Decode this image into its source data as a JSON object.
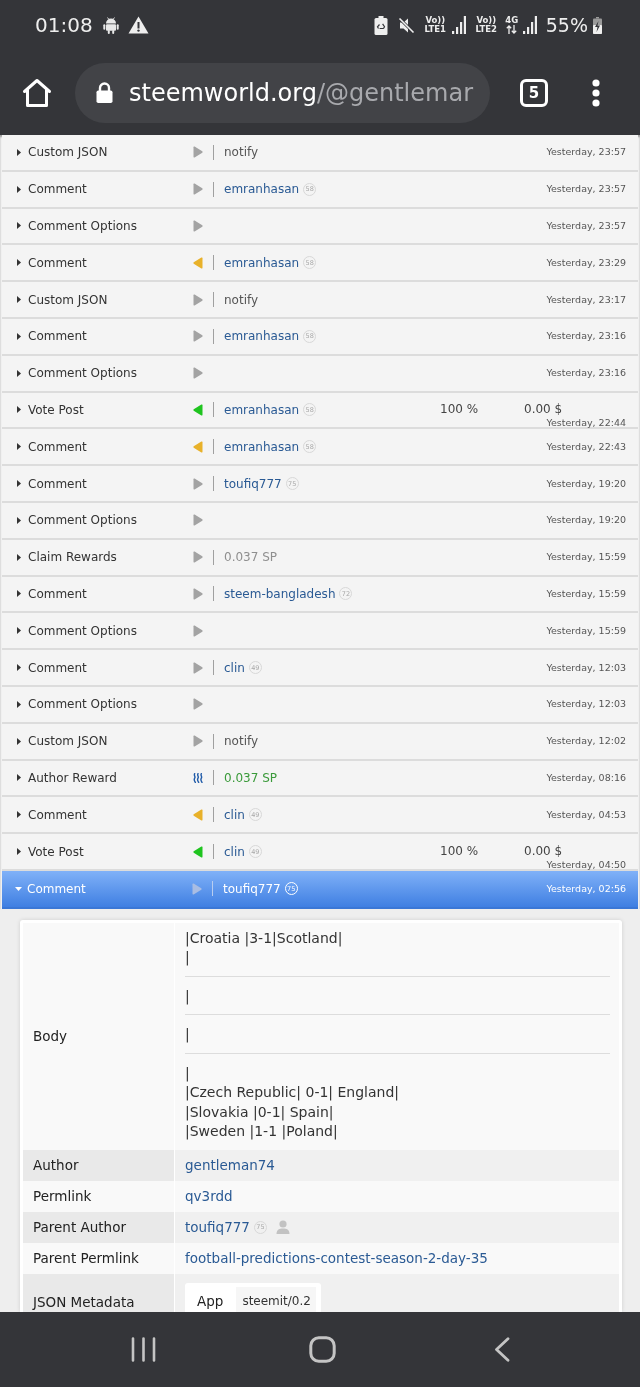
{
  "status_bar": {
    "time": "01:08",
    "sims": [
      {
        "volte": "Vo))",
        "band": "LTE1"
      },
      {
        "volte": "Vo))",
        "band": "LTE2",
        "network": "4G"
      }
    ],
    "battery": "55%"
  },
  "browser": {
    "url_host": "steemworld.org",
    "url_path": "/@gentlemar",
    "tab_count": "5"
  },
  "operations": [
    {
      "type": "Custom JSON",
      "kind": "out",
      "target": {
        "kind": "plain",
        "text": "notify"
      },
      "time": "Yesterday, 23:57",
      "expanded": false
    },
    {
      "type": "Comment",
      "kind": "out",
      "target": {
        "kind": "account",
        "text": "emranhasan",
        "reputation": "58"
      },
      "time": "Yesterday, 23:57",
      "expanded": false
    },
    {
      "type": "Comment Options",
      "kind": "out",
      "time": "Yesterday, 23:57",
      "expanded": false
    },
    {
      "type": "Comment",
      "kind": "in",
      "target": {
        "kind": "account",
        "text": "emranhasan",
        "reputation": "58"
      },
      "time": "Yesterday, 23:29",
      "expanded": false
    },
    {
      "type": "Custom JSON",
      "kind": "out",
      "target": {
        "kind": "plain",
        "text": "notify"
      },
      "time": "Yesterday, 23:17",
      "expanded": false
    },
    {
      "type": "Comment",
      "kind": "out",
      "target": {
        "kind": "account",
        "text": "emranhasan",
        "reputation": "58"
      },
      "time": "Yesterday, 23:16",
      "expanded": false
    },
    {
      "type": "Comment Options",
      "kind": "out",
      "time": "Yesterday, 23:16",
      "expanded": false
    },
    {
      "type": "Vote Post",
      "kind": "upvote",
      "target": {
        "kind": "account",
        "text": "emranhasan",
        "reputation": "58"
      },
      "percent": "100 %",
      "value": "0.00 $",
      "time": "Yesterday, 22:44",
      "expanded": false
    },
    {
      "type": "Comment",
      "kind": "in",
      "target": {
        "kind": "account",
        "text": "emranhasan",
        "reputation": "58"
      },
      "time": "Yesterday, 22:43",
      "expanded": false
    },
    {
      "type": "Comment",
      "kind": "out",
      "target": {
        "kind": "account",
        "text": "toufiq777",
        "reputation": "75"
      },
      "time": "Yesterday, 19:20",
      "expanded": false
    },
    {
      "type": "Comment Options",
      "kind": "out",
      "time": "Yesterday, 19:20",
      "expanded": false
    },
    {
      "type": "Claim Rewards",
      "kind": "out",
      "target": {
        "kind": "claim",
        "text": "0.037 SP"
      },
      "time": "Yesterday, 15:59",
      "expanded": false
    },
    {
      "type": "Comment",
      "kind": "out",
      "target": {
        "kind": "account",
        "text": "steem-bangladesh",
        "reputation": "72"
      },
      "time": "Yesterday, 15:59",
      "expanded": false
    },
    {
      "type": "Comment Options",
      "kind": "out",
      "time": "Yesterday, 15:59",
      "expanded": false
    },
    {
      "type": "Comment",
      "kind": "out",
      "target": {
        "kind": "account",
        "text": "clin",
        "reputation": "49"
      },
      "time": "Yesterday, 12:03",
      "expanded": false
    },
    {
      "type": "Comment Options",
      "kind": "out",
      "time": "Yesterday, 12:03",
      "expanded": false
    },
    {
      "type": "Custom JSON",
      "kind": "out",
      "target": {
        "kind": "plain",
        "text": "notify"
      },
      "time": "Yesterday, 12:02",
      "expanded": false
    },
    {
      "type": "Author Reward",
      "kind": "reward",
      "target": {
        "kind": "reward",
        "text": "0.037 SP"
      },
      "time": "Yesterday, 08:16",
      "expanded": false
    },
    {
      "type": "Comment",
      "kind": "in",
      "target": {
        "kind": "account",
        "text": "clin",
        "reputation": "49"
      },
      "time": "Yesterday, 04:53",
      "expanded": false
    },
    {
      "type": "Vote Post",
      "kind": "upvote",
      "target": {
        "kind": "account",
        "text": "clin",
        "reputation": "49"
      },
      "percent": "100 %",
      "value": "0.00 $",
      "time": "Yesterday, 04:50",
      "expanded": false
    },
    {
      "type": "Comment",
      "kind": "out",
      "target": {
        "kind": "account",
        "text": "toufiq777",
        "reputation": "75"
      },
      "time": "Yesterday, 02:56",
      "expanded": true
    }
  ],
  "details": {
    "body_label": "Body",
    "body": [
      [
        "|Croatia |3-1|Scotland|",
        "|"
      ],
      [
        "|"
      ],
      [
        "|"
      ],
      [
        "|",
        "|Czech Republic| 0-1| England|",
        "|Slovakia |0-1| Spain|",
        "|Sweden |1-1 |Poland|"
      ]
    ],
    "fields": [
      {
        "label": "Author",
        "value": "gentleman74",
        "kind": "link"
      },
      {
        "label": "Permlink",
        "value": "qv3rdd",
        "kind": "link"
      },
      {
        "label": "Parent Author",
        "value": "toufiq777",
        "kind": "account",
        "reputation": "75"
      },
      {
        "label": "Parent Permlink",
        "value": "football-predictions-contest-season-2-day-35",
        "kind": "link"
      }
    ],
    "metadata": {
      "label": "JSON Metadata",
      "entries": [
        {
          "key": "App",
          "value": "steemit/0.2"
        }
      ]
    }
  }
}
